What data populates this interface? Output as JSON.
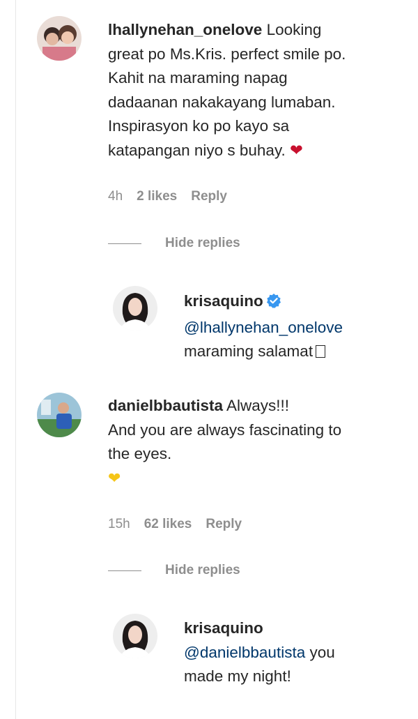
{
  "comments": [
    {
      "username": "lhallynehan_onelove",
      "text_lines": [
        " Looking",
        "great po Ms.Kris. perfect smile po.",
        "Kahit na maraming napag",
        "dadaanan nakakayang lumaban.",
        "Inspirasyon ko po kayo sa",
        "katapangan niyo s buhay. "
      ],
      "emoji": "heart-red",
      "time": "4h",
      "likes": "2 likes",
      "reply_label": "Reply",
      "hide_replies_label": "Hide replies",
      "reply": {
        "username": "krisaquino",
        "verified": true,
        "mention": "@lhallynehan_onelove",
        "text": "maraming salamat"
      }
    },
    {
      "username": "danielbbautista",
      "text_lines": [
        " Always!!!",
        "And you are always fascinating to",
        "the eyes."
      ],
      "emoji": "heart-yellow",
      "time": "15h",
      "likes": "62 likes",
      "reply_label": "Reply",
      "hide_replies_label": "Hide replies",
      "reply": {
        "username": "krisaquino",
        "mention": "@danielbbautista",
        "text_after_mention": " you",
        "text_line2": "made my night!"
      }
    }
  ],
  "colors": {
    "text": "#262626",
    "muted": "#8e8e8e",
    "mention": "#00376b",
    "verified": "#3897f0",
    "heart_red": "#c8102e",
    "heart_yellow": "#f5c518"
  }
}
